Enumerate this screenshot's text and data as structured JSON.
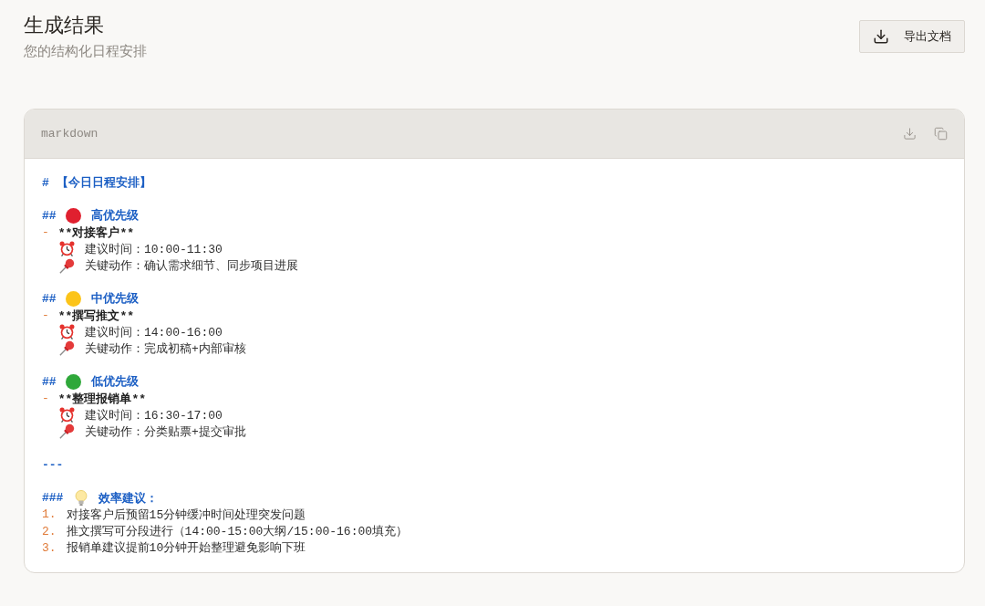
{
  "header": {
    "title": "生成结果",
    "subtitle": "您的结构化日程安排"
  },
  "export_button": {
    "label": "导出文档"
  },
  "code_block": {
    "language": "markdown",
    "title_line": {
      "marker": "#",
      "text": "【今日日程安排】"
    },
    "priorities": [
      {
        "marker": "##",
        "color": "#e0202f",
        "heading": "高优先级",
        "bullet": "-",
        "task": "**对接客户**",
        "details": [
          {
            "kind": "time",
            "text": "建议时间：10:00-11:30"
          },
          {
            "kind": "action",
            "text": "关键动作：确认需求细节、同步项目进展"
          }
        ]
      },
      {
        "marker": "##",
        "color": "#fcc419",
        "heading": "中优先级",
        "bullet": "-",
        "task": "**撰写推文**",
        "details": [
          {
            "kind": "time",
            "text": "建议时间：14:00-16:00"
          },
          {
            "kind": "action",
            "text": "关键动作：完成初稿+内部审核"
          }
        ]
      },
      {
        "marker": "##",
        "color": "#2fa83a",
        "heading": "低优先级",
        "bullet": "-",
        "task": "**整理报销单**",
        "details": [
          {
            "kind": "time",
            "text": "建议时间：16:30-17:00"
          },
          {
            "kind": "action",
            "text": "关键动作：分类贴票+提交审批"
          }
        ]
      }
    ],
    "divider": "---",
    "tips": {
      "marker": "###",
      "heading": "效率建议：",
      "items": [
        {
          "number": "1.",
          "text": "对接客户后预留15分钟缓冲时间处理突发问题"
        },
        {
          "number": "2.",
          "text": "推文撰写可分段进行（14:00-15:00大纲/15:00-16:00填充）"
        },
        {
          "number": "3.",
          "text": "报销单建议提前10分钟开始整理避免影响下班"
        }
      ]
    }
  }
}
